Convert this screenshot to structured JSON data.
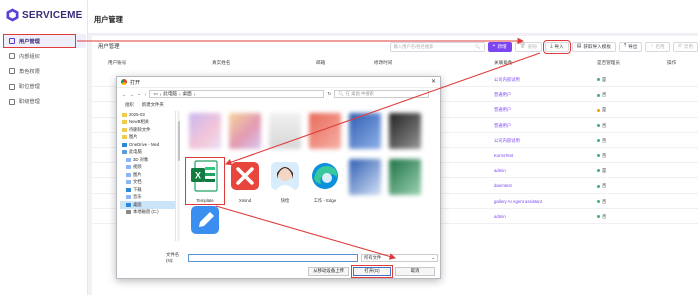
{
  "brand": {
    "logo_text": "SERVICEME"
  },
  "sidebar": {
    "items": [
      {
        "label": "用户管理",
        "active": true
      },
      {
        "label": "内部组织"
      },
      {
        "label": "角色权限"
      },
      {
        "label": "职位管理"
      },
      {
        "label": "职级管理"
      }
    ]
  },
  "header": {
    "title": "用户管理"
  },
  "main": {
    "list_title": "用户管理",
    "search_placeholder": "输入用户名/姓名搜索",
    "buttons": {
      "new": "新增",
      "delete": "删除",
      "import": "导入",
      "download_template": "获取导入模板",
      "export": "导出",
      "enable": "启用",
      "disable": "禁用"
    },
    "columns": [
      "用户账号",
      "真实姓名",
      "邮箱",
      "修改时间",
      "关联角色",
      "是否管理员",
      "操作"
    ],
    "rows": [
      {
        "role": "公司内部试用",
        "admin": "是",
        "admin_color": "#3cb371"
      },
      {
        "role": "普通用户",
        "admin": "否",
        "admin_color": "#3cb371"
      },
      {
        "role": "普通用户",
        "admin": "是",
        "admin_color": "#f0a000"
      },
      {
        "role": "普通用户",
        "admin": "否",
        "admin_color": "#3cb371"
      },
      {
        "role": "公司内部试用",
        "admin": "否",
        "admin_color": "#3cb371"
      },
      {
        "role": "KornsTest",
        "admin": "否",
        "admin_color": "#3cb371"
      },
      {
        "role": "admin",
        "admin": "是",
        "admin_color": "#3cb371"
      },
      {
        "role": "daemtest",
        "admin": "否",
        "admin_color": "#3cb371"
      },
      {
        "role": "gallery AI Agent assistant",
        "admin": "否",
        "admin_color": "#3cb371"
      },
      {
        "role": "admin",
        "admin": "否",
        "admin_color": "#3cb371"
      }
    ]
  },
  "dialog": {
    "title": "打开",
    "address": [
      "此电脑",
      "桌面"
    ],
    "search_placeholder": "在 桌面 中搜索",
    "commands": [
      "组织",
      "新建文件夹"
    ],
    "nav_items": [
      {
        "label": "2025-03",
        "color": "#f2c94c"
      },
      {
        "label": "NewB相关",
        "color": "#f2c94c"
      },
      {
        "label": "待删除文件",
        "color": "#f2c94c"
      },
      {
        "label": "图片",
        "color": "#f2c94c"
      },
      {
        "label": "OneDrive - Med",
        "color": "#2b88d8"
      },
      {
        "label": "此电脑",
        "color": "#5b9bd5"
      },
      {
        "label": "3D 对象",
        "color": "#8ab4f8"
      },
      {
        "label": "视频",
        "color": "#8ab4f8"
      },
      {
        "label": "图片",
        "color": "#8ab4f8"
      },
      {
        "label": "文档",
        "color": "#8ab4f8"
      },
      {
        "label": "下载",
        "color": "#2b88d8"
      },
      {
        "label": "音乐",
        "color": "#8ab4f8"
      },
      {
        "label": "桌面",
        "color": "#2b88d8",
        "selected": true
      },
      {
        "label": "本地磁盘 (C:)",
        "color": "#888888"
      }
    ],
    "visible_files": {
      "template": "Template",
      "xmind": "Xmind",
      "avatar": "快绘",
      "edge": "工作 - Edge"
    },
    "filename_label": "文件名(N):",
    "filetype": "所有文件",
    "upload_btn": "从移动设备上传",
    "open_btn": "打开(O)",
    "cancel_btn": "取消"
  }
}
